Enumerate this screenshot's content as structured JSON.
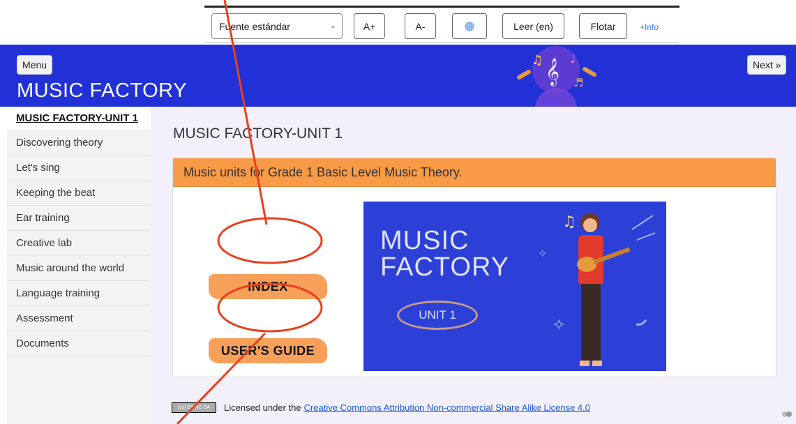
{
  "toolbar": {
    "font_select": "Fuente estándar",
    "increase_font": "A+",
    "decrease_font": "A-",
    "globe_icon": "globe-icon",
    "read_label": "Leer (en)",
    "float_label": "Flotar",
    "info_link": "+Info"
  },
  "header": {
    "menu_label": "Menu",
    "next_label": "Next »",
    "site_title": "MUSIC FACTORY",
    "background_color": "#2231d6"
  },
  "sidebar": {
    "items": [
      {
        "label": "MUSIC FACTORY-UNIT 1",
        "active": true
      },
      {
        "label": "Discovering theory"
      },
      {
        "label": "Let's sing"
      },
      {
        "label": "Keeping the beat"
      },
      {
        "label": "Ear training"
      },
      {
        "label": "Creative lab"
      },
      {
        "label": "Music around the world"
      },
      {
        "label": "Language training"
      },
      {
        "label": "Assessment"
      },
      {
        "label": "Documents"
      }
    ]
  },
  "main": {
    "page_title": "MUSIC FACTORY-UNIT 1",
    "card_header": "Music units for Grade 1 Basic Level Music Theory.",
    "index_button": "INDEX",
    "guide_button": "USER'S GUIDE",
    "cover_title_line1": "MUSIC",
    "cover_title_line2": "FACTORY",
    "cover_unit": "UNIT 1"
  },
  "footer": {
    "badge": "(cc) BY-NC-SA",
    "text": "Licensed under the",
    "link": "Creative Commons Attribution Non-commercial Share Alike License 4.0"
  },
  "colors": {
    "accent_orange": "#f99a46",
    "annotation_red": "#e8401c",
    "cover_blue": "#2c3fd7"
  }
}
